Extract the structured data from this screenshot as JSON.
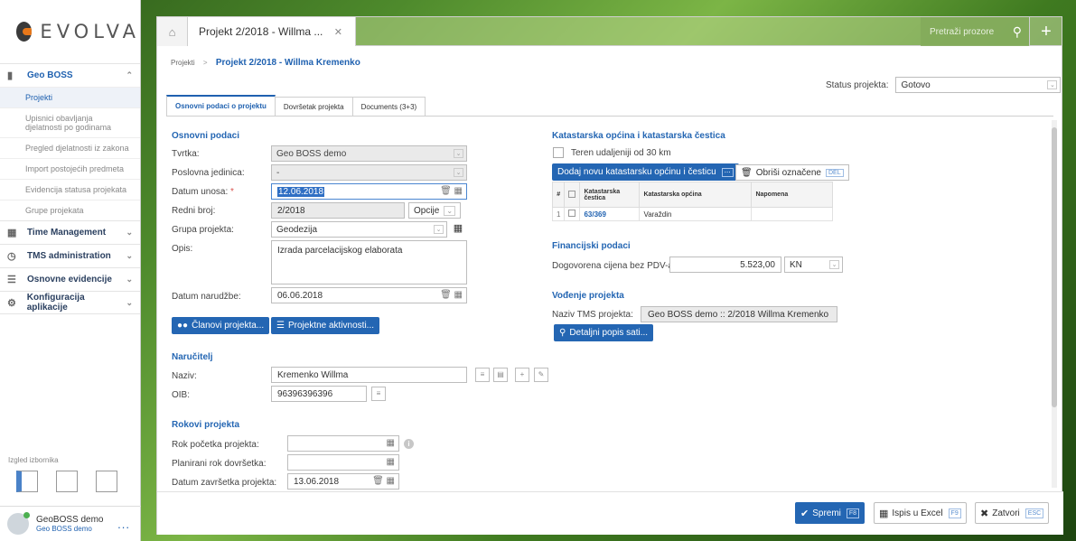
{
  "sidebar": {
    "logo_text": "EVOLVA",
    "module": "Geo BOSS",
    "sub_items": [
      "Projekti",
      "Upisnici obavljanja djelatnosti po godinama",
      "Pregled djelatnosti iz zakona",
      "Import postojećih predmeta",
      "Evidencija statusa projekata",
      "Grupe projekata"
    ],
    "nav": [
      "Time Management",
      "TMS administration",
      "Osnovne evidencije",
      "Konfiguracija aplikacije"
    ],
    "layout_label": "Izgled izbornika",
    "user_name": "GeoBOSS demo",
    "user_org": "Geo BOSS demo",
    "more": "..."
  },
  "topbar": {
    "tab_title": "Projekt 2/2018 - Willma ...",
    "tab_close": "✕",
    "search_placeholder": "Pretraži prozore",
    "plus": "+"
  },
  "breadcrumb": {
    "root": "Projekti",
    "separator": ">",
    "current": "Projekt 2/2018 - Willma Kremenko"
  },
  "status": {
    "label": "Status projekta:",
    "value": "Gotovo"
  },
  "tabs": [
    "Osnovni podaci o projektu",
    "Dovršetak projekta",
    "Documents (3+3)"
  ],
  "osnovni": {
    "title": "Osnovni podaci",
    "tvrtka_label": "Tvrtka:",
    "tvrtka_value": "Geo BOSS demo",
    "jedinica_label": "Poslovna jedinica:",
    "jedinica_value": "-",
    "datum_unosa_label": "Datum unosa:",
    "required_mark": "*",
    "datum_unosa_value": "12.06.2018",
    "redni_label": "Redni broj:",
    "redni_value": "2/2018",
    "opcije": "Opcije",
    "grupa_label": "Grupa projekta:",
    "grupa_value": "Geodezija",
    "opis_label": "Opis:",
    "opis_value": "Izrada parcelacijskog elaborata",
    "narudzba_label": "Datum narudžbe:",
    "narudzba_value": "06.06.2018",
    "btn_clanovi": "Članovi projekta...",
    "btn_aktivnosti": "Projektne aktivnosti..."
  },
  "narucitelj": {
    "title": "Naručitelj",
    "naziv_label": "Naziv:",
    "naziv_value": "Kremenko Willma",
    "oib_label": "OIB:",
    "oib_value": "96396396396"
  },
  "rokovi": {
    "title": "Rokovi projekta",
    "pocetak_label": "Rok početka projekta:",
    "pocetak_value": "",
    "planirani_label": "Planirani rok dovršetka:",
    "planirani_value": "",
    "zavrsetak_label": "Datum završetka projekta:",
    "zavrsetak_value": "13.06.2018"
  },
  "katastar": {
    "title": "Katastarska općina i katastarska čestica",
    "teren_label": "Teren udaljeniji od 30 km",
    "btn_add": "Dodaj novu katastarsku općinu i česticu",
    "btn_delete": "Obriši označene",
    "del_key": "DEL",
    "columns": [
      "#",
      "Katastarska čestica",
      "Katastarska općina",
      "Napomena"
    ],
    "rows": [
      {
        "num": "1",
        "cestica": "63/369",
        "opcina": "Varaždin",
        "napomena": ""
      }
    ]
  },
  "financije": {
    "title": "Financijski podaci",
    "cijena_label": "Dogovorena cijena bez PDV-a:",
    "cijena_value": "5.523,00",
    "valuta": "KN"
  },
  "vodenje": {
    "title": "Vođenje projekta",
    "tms_label": "Naziv TMS projekta:",
    "tms_value": "Geo BOSS demo :: 2/2018 Willma Kremenko",
    "btn_sati": "Detaljni popis sati..."
  },
  "footer": {
    "save": "Spremi",
    "save_key": "F8",
    "excel": "Ispis u Excel",
    "excel_key": "F9",
    "close": "Zatvori",
    "close_key": "ESC"
  }
}
